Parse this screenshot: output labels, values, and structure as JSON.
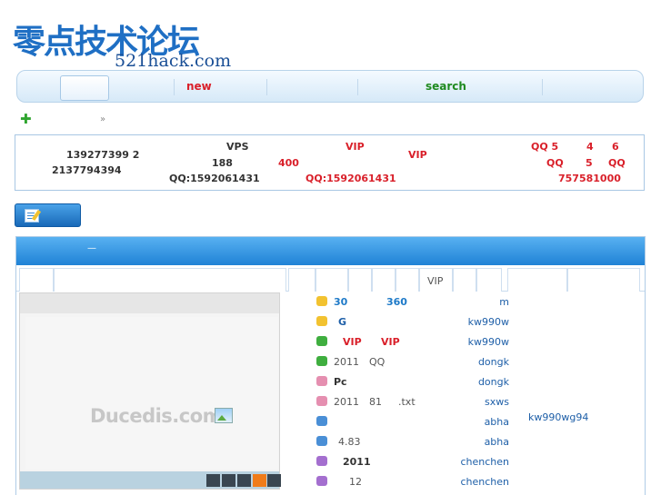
{
  "logo": {
    "cn": "零点技术论坛",
    "en": "521hack.com"
  },
  "nav": {
    "items": [
      {
        "label": "new",
        "color": "#d9202a"
      },
      {
        "label": "search",
        "color": "#1f8a1f"
      }
    ]
  },
  "notice": {
    "col1": [
      "139277399  2",
      "2137794394"
    ],
    "col2": [
      "VPS",
      "188",
      "QQ:1592061431"
    ],
    "col3": [
      "400",
      "VIP",
      "QQ:1592061431"
    ],
    "col4": [
      "VIP"
    ],
    "col5": [
      "QQ  5",
      "4",
      "6",
      "QQ",
      "5",
      "QQ",
      "757581000"
    ]
  },
  "tabs": {
    "vip_label": "VIP"
  },
  "slide": {
    "brand": "Ducedis.com",
    "dots": 5,
    "active_dot": 4
  },
  "threads": [
    {
      "title": "30",
      "title2": "360",
      "icon_color": "#f2c230",
      "title_color": "#1e7ac8",
      "author": "m"
    },
    {
      "title": "G",
      "title2": "",
      "icon_color": "#f2c230",
      "title_color": "#1e5fa8",
      "author": "kw990w"
    },
    {
      "title": "VIP",
      "title2": "VIP",
      "icon_color": "#3fae3f",
      "title_color": "#d9202a",
      "author": "kw990w"
    },
    {
      "title": "2011",
      "title2": "QQ",
      "icon_color": "#3fae3f",
      "title_color": "#555",
      "author": "dongk"
    },
    {
      "title": "Pc",
      "title2": "",
      "icon_color": "#e58fb0",
      "title_color": "#333",
      "author": "dongk"
    },
    {
      "title": "2011",
      "title2": "81",
      "title3": ".txt",
      "icon_color": "#e58fb0",
      "title_color": "#555",
      "author": "sxws"
    },
    {
      "title": "",
      "title2": "",
      "icon_color": "#4a8fd6",
      "title_color": "#555",
      "author": "abha"
    },
    {
      "title": "4.83",
      "title2": "",
      "icon_color": "#4a8fd6",
      "title_color": "#555",
      "author": "abha"
    },
    {
      "title": "2011",
      "title2": "",
      "icon_color": "#a46fcf",
      "title_color": "#333",
      "author": "chenchen"
    },
    {
      "title": "12",
      "title2": "",
      "icon_color": "#a46fcf",
      "title_color": "#555",
      "author": "chenchen"
    }
  ],
  "side": {
    "name": "kw990wg94"
  }
}
